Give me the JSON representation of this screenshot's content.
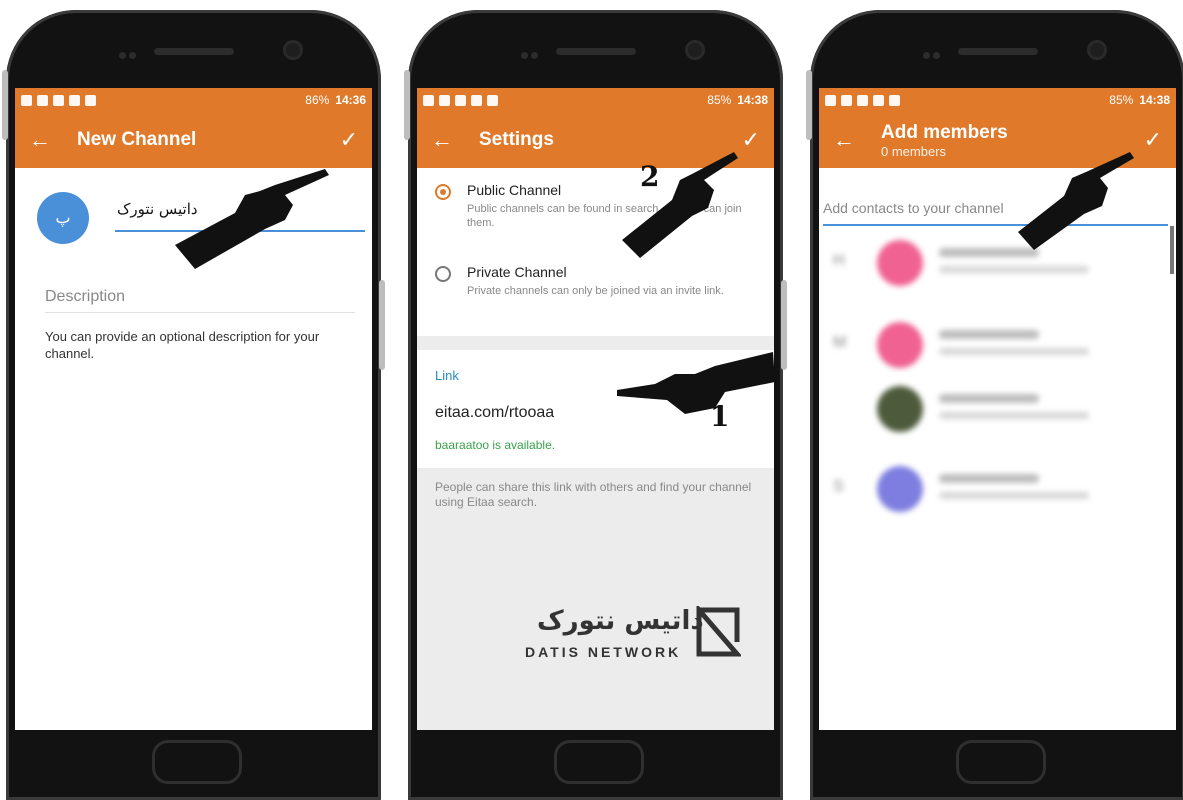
{
  "status": {
    "phone1": {
      "battery": "86%",
      "time": "14:36"
    },
    "phone2": {
      "battery": "85%",
      "time": "14:38"
    },
    "phone3": {
      "battery": "85%",
      "time": "14:38"
    }
  },
  "screen1": {
    "title": "New Channel",
    "avatar_initial": "پ",
    "channel_name": "داتیس نتورک",
    "description_placeholder": "Description",
    "description_help": "You can provide an optional description for your channel."
  },
  "screen2": {
    "title": "Settings",
    "public_title": "Public Channel",
    "public_desc": "Public channels can be found in search, anyone can join them.",
    "private_title": "Private Channel",
    "private_desc": "Private channels can only be joined via an invite link.",
    "link_label": "Link",
    "link_value": "eitaa.com/rtooaa",
    "link_status": "baaraatoo is available.",
    "link_help": "People can share this link with others and find your channel using Eitaa search.",
    "watermark_fa": "داتیس نتورک",
    "watermark_en": "DATIS NETWORK",
    "step1": "1",
    "step2": "2"
  },
  "screen3": {
    "title": "Add members",
    "subtitle": "0 members",
    "search_placeholder": "Add contacts to your channel",
    "letters": [
      "H",
      "M",
      "S"
    ]
  },
  "colors": {
    "accent": "#e07a2a",
    "link": "#2a8cc4",
    "available": "#3aa24a",
    "avatar": "#4a90d9"
  },
  "icons": [
    "back-arrow-icon",
    "check-icon",
    "radio-icon",
    "pointing-hand-icon"
  ]
}
